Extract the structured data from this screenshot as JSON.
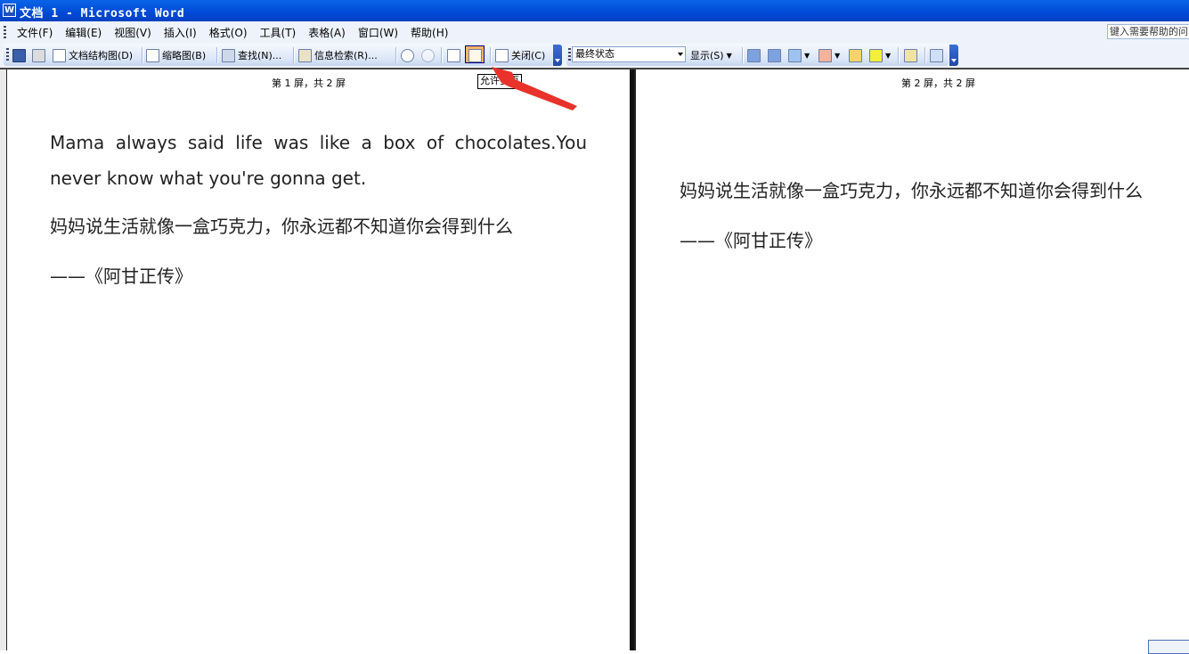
{
  "window": {
    "title": "文档 1 - Microsoft Word",
    "icon": "word-doc-icon"
  },
  "menubar": {
    "items": [
      "文件(F)",
      "编辑(E)",
      "视图(V)",
      "插入(I)",
      "格式(O)",
      "工具(T)",
      "表格(A)",
      "窗口(W)",
      "帮助(H)"
    ],
    "help_placeholder": "键入需要帮助的问"
  },
  "toolbar": {
    "document_map": "文档结构图(D)",
    "thumbnails": "缩略图(B)",
    "find": "查找(N)...",
    "research": "信息检索(R)...",
    "close": "关闭(C)",
    "markup_state": "最终状态",
    "show": "显示(S)",
    "icons": [
      "save-icon",
      "print-icon",
      "document-map-icon",
      "thumbnails-icon",
      "find-icon",
      "research-icon",
      "zoom-in-icon",
      "zoom-out-icon",
      "page-icon",
      "reading-layout-icon",
      "close-reading-icon",
      "previous-change-icon",
      "next-change-icon",
      "accept-change-icon",
      "reject-change-icon",
      "new-comment-icon",
      "highlight-icon",
      "track-changes-icon",
      "reviewing-pane-icon"
    ]
  },
  "reading": {
    "left_label": "第 1 屏，共 2 屏",
    "right_label": "第 2 屏，共 2 屏",
    "tooltip": "允许多页",
    "left_text_en": "Mama always said life was like a box of chocolates.You never know what you're gonna get.",
    "left_text_zh": "妈妈说生活就像一盒巧克力，你永远都不知道你会得到什么",
    "left_source": "——《阿甘正传》",
    "right_text_zh": "妈妈说生活就像一盒巧克力，你永远都不知道你会得到什么",
    "right_source": "——《阿甘正传》"
  },
  "annotation": {
    "color": "#e8322b"
  }
}
